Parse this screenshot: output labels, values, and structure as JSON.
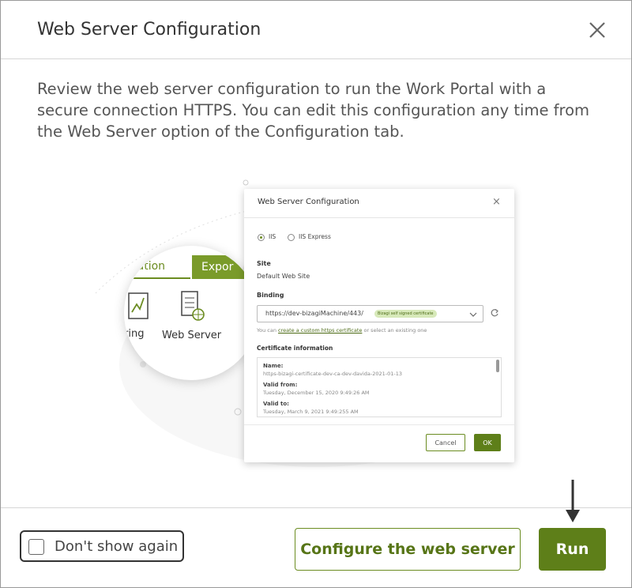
{
  "dialog": {
    "title": "Web Server Configuration",
    "description": "Review the web server configuration to run the Work Portal with a secure connection HTTPS. You can edit this configuration any time from the Web Server option of the Configuration tab.",
    "close_icon": "close-icon"
  },
  "illustration": {
    "lens": {
      "tab_partial": "uration",
      "tab_export_partial": "Expor",
      "item_partial": "ring",
      "item_web_server": "Web Server"
    },
    "mini_dialog": {
      "title": "Web Server Configuration",
      "radio_iis": "IIS",
      "radio_iis_express": "IIS Express",
      "site_label": "Site",
      "site_value": "Default Web Site",
      "binding_label": "Binding",
      "binding_value": "https://dev-bizagiMachine/443/",
      "binding_badge": "Bizagi self signed certificate",
      "hint_prefix": "You can",
      "hint_link": "create a custom https certificate",
      "hint_suffix": "or select an existing one",
      "cert_label": "Certificate information",
      "cert_name_label": "Name:",
      "cert_name_value": "https-bizagi-certificate-dev-ca-dev-davida-2021-01-13",
      "valid_from_label": "Valid from:",
      "valid_from_value": "Tuesday, December 15, 2020 9:49:26 AM",
      "valid_to_label": "Valid to:",
      "valid_to_value": "Tuesday, March 9, 2021 9:49:255 AM",
      "cancel_label": "Cancel",
      "ok_label": "OK"
    }
  },
  "footer": {
    "checkbox_label": "Don't show again",
    "checkbox_checked": false,
    "configure_button": "Configure the web server",
    "run_button": "Run"
  },
  "colors": {
    "accent": "#5e7f19",
    "accent_border": "#6b8c21"
  }
}
